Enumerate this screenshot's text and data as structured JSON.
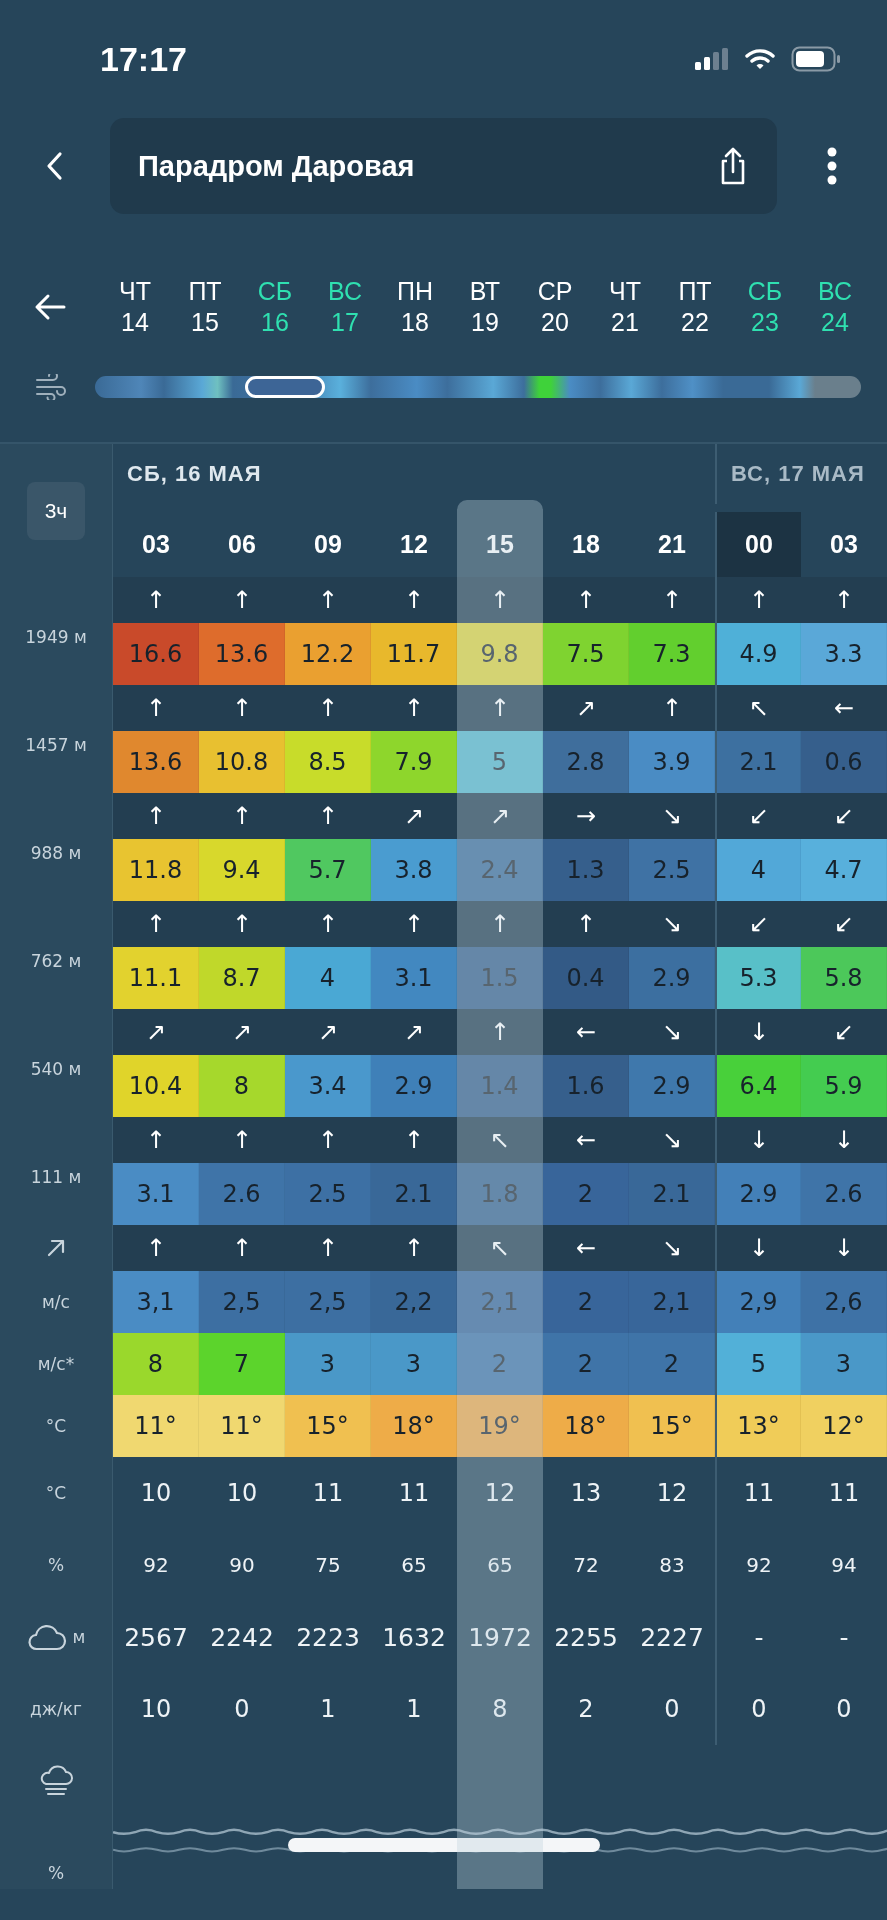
{
  "status_bar": {
    "time": "17:17"
  },
  "header": {
    "title": "Парадром Даровая"
  },
  "days": [
    {
      "dow": "ЧТ",
      "date": "14",
      "weekend": false
    },
    {
      "dow": "ПТ",
      "date": "15",
      "weekend": false
    },
    {
      "dow": "СБ",
      "date": "16",
      "weekend": true
    },
    {
      "dow": "ВС",
      "date": "17",
      "weekend": true
    },
    {
      "dow": "ПН",
      "date": "18",
      "weekend": false
    },
    {
      "dow": "ВТ",
      "date": "19",
      "weekend": false
    },
    {
      "dow": "СР",
      "date": "20",
      "weekend": false
    },
    {
      "dow": "ЧТ",
      "date": "21",
      "weekend": false
    },
    {
      "dow": "ПТ",
      "date": "22",
      "weekend": false
    },
    {
      "dow": "СБ",
      "date": "23",
      "weekend": true
    },
    {
      "dow": "ВС",
      "date": "24",
      "weekend": true
    }
  ],
  "table": {
    "interval_button": "3ч",
    "day_groups": [
      {
        "label": "СБ, 16 МАЯ",
        "hours": [
          {
            "hour": "03",
            "selected": false,
            "current": false
          },
          {
            "hour": "06",
            "selected": false,
            "current": false
          },
          {
            "hour": "09",
            "selected": false,
            "current": false
          },
          {
            "hour": "12",
            "selected": false,
            "current": false
          },
          {
            "hour": "15",
            "selected": true,
            "current": false
          },
          {
            "hour": "18",
            "selected": false,
            "current": false
          },
          {
            "hour": "21",
            "selected": false,
            "current": false
          }
        ]
      },
      {
        "label": "ВС, 17 МАЯ",
        "hours": [
          {
            "hour": "00",
            "selected": false,
            "current": true
          },
          {
            "hour": "03",
            "selected": false,
            "current": false
          }
        ]
      }
    ],
    "rows": [
      {
        "kind": "arrows",
        "directions": [
          "↑",
          "↑",
          "↑",
          "↑",
          "↑",
          "↑",
          "↑",
          "↑",
          "↑"
        ]
      },
      {
        "kind": "band",
        "label": "1949 м",
        "cells": [
          {
            "value": "16.6",
            "color": "#c94a2a"
          },
          {
            "value": "13.6",
            "color": "#de6c2c"
          },
          {
            "value": "12.2",
            "color": "#eaa030"
          },
          {
            "value": "11.7",
            "color": "#e8b82c"
          },
          {
            "value": "9.8",
            "color": "#d4d373"
          },
          {
            "value": "7.5",
            "color": "#7fd330"
          },
          {
            "value": "7.3",
            "color": "#62cf2e"
          },
          {
            "value": "4.9",
            "color": "#4fb0d8"
          },
          {
            "value": "3.3",
            "color": "#5aa8d8"
          }
        ]
      },
      {
        "kind": "arrows",
        "directions": [
          "↑",
          "↑",
          "↑",
          "↑",
          "↑",
          "↗",
          "↑",
          "↖",
          "←"
        ]
      },
      {
        "kind": "band",
        "label": "1457 м",
        "cells": [
          {
            "value": "13.6",
            "color": "#e0882e"
          },
          {
            "value": "10.8",
            "color": "#e8c030"
          },
          {
            "value": "8.5",
            "color": "#c8dc2a"
          },
          {
            "value": "7.9",
            "color": "#8ed62c"
          },
          {
            "value": "5",
            "color": "#7ac1d2"
          },
          {
            "value": "2.8",
            "color": "#3f6e9c"
          },
          {
            "value": "3.9",
            "color": "#4a8cc4"
          },
          {
            "value": "2.1",
            "color": "#3d70a0"
          },
          {
            "value": "0.6",
            "color": "#365f8c"
          }
        ]
      },
      {
        "kind": "arrows",
        "directions": [
          "↑",
          "↑",
          "↑",
          "↗",
          "↗",
          "→",
          "↘",
          "↙",
          "↙"
        ]
      },
      {
        "kind": "band",
        "label": "988 м",
        "cells": [
          {
            "value": "11.8",
            "color": "#e8c430"
          },
          {
            "value": "9.4",
            "color": "#d8d82c"
          },
          {
            "value": "5.7",
            "color": "#50c860"
          },
          {
            "value": "3.8",
            "color": "#4a9cd0"
          },
          {
            "value": "2.4",
            "color": "#688fb1"
          },
          {
            "value": "1.3",
            "color": "#365f8c"
          },
          {
            "value": "2.5",
            "color": "#3f72a4"
          },
          {
            "value": "4",
            "color": "#52a8d8"
          },
          {
            "value": "4.7",
            "color": "#58b0dc"
          }
        ]
      },
      {
        "kind": "arrows",
        "directions": [
          "↑",
          "↑",
          "↑",
          "↑",
          "↑",
          "↑",
          "↘",
          "↙",
          "↙"
        ]
      },
      {
        "kind": "band",
        "label": "762 м",
        "cells": [
          {
            "value": "11.1",
            "color": "#e2d22e"
          },
          {
            "value": "8.7",
            "color": "#c0d82a"
          },
          {
            "value": "4",
            "color": "#4aa8d4"
          },
          {
            "value": "3.1",
            "color": "#4288c0"
          },
          {
            "value": "1.5",
            "color": "#6587a8"
          },
          {
            "value": "0.4",
            "color": "#335a86"
          },
          {
            "value": "2.9",
            "color": "#3c6fa0"
          },
          {
            "value": "5.3",
            "color": "#58c0c8"
          },
          {
            "value": "5.8",
            "color": "#4cc85a"
          }
        ]
      },
      {
        "kind": "arrows",
        "directions": [
          "↗",
          "↗",
          "↗",
          "↗",
          "↑",
          "←",
          "↘",
          "↓",
          "↙"
        ]
      },
      {
        "kind": "band",
        "label": "540 м",
        "cells": [
          {
            "value": "10.4",
            "color": "#e0d42a"
          },
          {
            "value": "8",
            "color": "#a6d82c"
          },
          {
            "value": "3.4",
            "color": "#4a98cc"
          },
          {
            "value": "2.9",
            "color": "#3f80b8"
          },
          {
            "value": "1.4",
            "color": "#6587a8"
          },
          {
            "value": "1.6",
            "color": "#365f8c"
          },
          {
            "value": "2.9",
            "color": "#3f78ac"
          },
          {
            "value": "6.4",
            "color": "#48d03a"
          },
          {
            "value": "5.9",
            "color": "#44cc50"
          }
        ]
      },
      {
        "kind": "arrows",
        "directions": [
          "↑",
          "↑",
          "↑",
          "↑",
          "↖",
          "←",
          "↘",
          "↓",
          "↓"
        ]
      },
      {
        "kind": "band",
        "label": "111 м",
        "cells": [
          {
            "value": "3.1",
            "color": "#4a8cc4"
          },
          {
            "value": "2.6",
            "color": "#3f74a8"
          },
          {
            "value": "2.5",
            "color": "#3d70a4"
          },
          {
            "value": "2.1",
            "color": "#396898"
          },
          {
            "value": "1.8",
            "color": "#6589aa"
          },
          {
            "value": "2",
            "color": "#38659a"
          },
          {
            "value": "2.1",
            "color": "#396898"
          },
          {
            "value": "2.9",
            "color": "#4380b8"
          },
          {
            "value": "2.6",
            "color": "#3f74a8"
          }
        ]
      },
      {
        "kind": "surface-arrows",
        "directions": [
          "↑",
          "↑",
          "↑",
          "↑",
          "↖",
          "←",
          "↘",
          "↓",
          "↓"
        ]
      },
      {
        "kind": "band",
        "label": "м/с",
        "cells": [
          {
            "value": "3,1",
            "color": "#4a8cc4"
          },
          {
            "value": "2,5",
            "color": "#3d6fa2"
          },
          {
            "value": "2,5",
            "color": "#3d6fa2"
          },
          {
            "value": "2,2",
            "color": "#396898"
          },
          {
            "value": "2,1",
            "color": "#668bb1"
          },
          {
            "value": "2",
            "color": "#38659a"
          },
          {
            "value": "2,1",
            "color": "#38669a"
          },
          {
            "value": "2,9",
            "color": "#4380b8"
          },
          {
            "value": "2,6",
            "color": "#3e72a6"
          }
        ]
      },
      {
        "kind": "band",
        "label": "м/с*",
        "cells": [
          {
            "value": "8",
            "color": "#9ad82c"
          },
          {
            "value": "7",
            "color": "#5cd42c"
          },
          {
            "value": "3",
            "color": "#4a98c8"
          },
          {
            "value": "3",
            "color": "#4a98c8"
          },
          {
            "value": "2",
            "color": "#6b94ba"
          },
          {
            "value": "2",
            "color": "#3f74a8"
          },
          {
            "value": "2",
            "color": "#3f74a8"
          },
          {
            "value": "5",
            "color": "#52b0d8"
          },
          {
            "value": "3",
            "color": "#4a98c8"
          }
        ]
      },
      {
        "kind": "band",
        "label": "°C",
        "cells": [
          {
            "value": "11°",
            "color": "#f0d870"
          },
          {
            "value": "11°",
            "color": "#f0d870"
          },
          {
            "value": "15°",
            "color": "#f0c050"
          },
          {
            "value": "18°",
            "color": "#eeac48"
          },
          {
            "value": "19°",
            "color": "#ddb67c"
          },
          {
            "value": "18°",
            "color": "#eeac48"
          },
          {
            "value": "15°",
            "color": "#f0c050"
          },
          {
            "value": "13°",
            "color": "#f0cc58"
          },
          {
            "value": "12°",
            "color": "#f0d060"
          }
        ]
      },
      {
        "kind": "plain",
        "label": "°C",
        "values": [
          "10",
          "10",
          "11",
          "11",
          "12",
          "13",
          "12",
          "11",
          "11"
        ]
      },
      {
        "kind": "small",
        "label": "%",
        "values": [
          "92",
          "90",
          "75",
          "65",
          "65",
          "72",
          "83",
          "92",
          "94"
        ]
      },
      {
        "kind": "cloud",
        "label": "м",
        "values": [
          "2567",
          "2242",
          "2223",
          "1632",
          "1972",
          "2255",
          "2227",
          "-",
          "-"
        ]
      },
      {
        "kind": "plain",
        "label": "дж/кг",
        "values": [
          "10",
          "0",
          "1",
          "1",
          "8",
          "2",
          "0",
          "0",
          "0"
        ]
      },
      {
        "kind": "fog"
      },
      {
        "kind": "wave",
        "label": "%"
      }
    ]
  }
}
